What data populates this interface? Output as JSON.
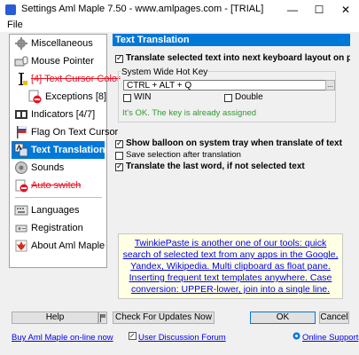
{
  "window": {
    "title": "Settings Aml Maple 7.50 - www.amlpages.com - [TRIAL]",
    "minimize": "—",
    "maximize": "☐",
    "close": "✕"
  },
  "menu": {
    "file": "File"
  },
  "nav": {
    "items": [
      {
        "label": "Miscellaneous",
        "icon": "gear-icon"
      },
      {
        "label": "Mouse Pointer",
        "icon": "keyboard-mouse-icon"
      },
      {
        "label": "[4] Text Cursor Color",
        "icon": "text-cursor-icon"
      },
      {
        "label": "Exceptions [8]",
        "icon": "no-entry-icon"
      },
      {
        "label": "Indicators [4/7]",
        "icon": "indicators-icon"
      },
      {
        "label": "Flag On Text Cursor",
        "icon": "flag-icon"
      },
      {
        "label": "Text Translation",
        "icon": "translation-icon"
      },
      {
        "label": "Sounds",
        "icon": "sound-icon"
      },
      {
        "label": "Auto switch",
        "icon": "auto-switch-icon"
      },
      {
        "label": "Languages",
        "icon": "languages-icon"
      },
      {
        "label": "Registration",
        "icon": "registration-icon"
      },
      {
        "label": "About Aml Maple",
        "icon": "maple-leaf-icon"
      }
    ]
  },
  "panel": {
    "header": "Text Translation",
    "translate_selected": "Translate selected text into next keyboard layout on pressing of hotkey (e.g",
    "group_label": "System Wide Hot Key",
    "hotkey_value": "CTRL + ALT + Q",
    "hotkey_button": "...",
    "win_label": "WIN",
    "double_label": "Double",
    "status": "It's OK. The key is already assigned",
    "show_balloon": "Show balloon on system tray when translate of text",
    "save_selection": "Save selection after translation",
    "translate_last_word": "Translate the last word, if not selected text",
    "promo": "TwinkiePaste is another one of our tools: quick search of selected text from any apps in the Google, Yandex, Wikipedia. Multi clipboard as float pane. Inserting frequent text templates anywhere. Case conversion: UPPER-lower, join into a single line."
  },
  "colors": {
    "accent": "#0078d7",
    "status_ok": "#2e9b2e",
    "strike": "#e81123",
    "link": "#0000ee"
  },
  "buttons": {
    "help": "Help",
    "check_updates": "Check For Updates Now",
    "ok": "OK",
    "cancel": "Cancel"
  },
  "links": {
    "buy": "Buy Aml Maple on-line now",
    "forum": "User Discussion Forum",
    "support": "Online Support"
  }
}
